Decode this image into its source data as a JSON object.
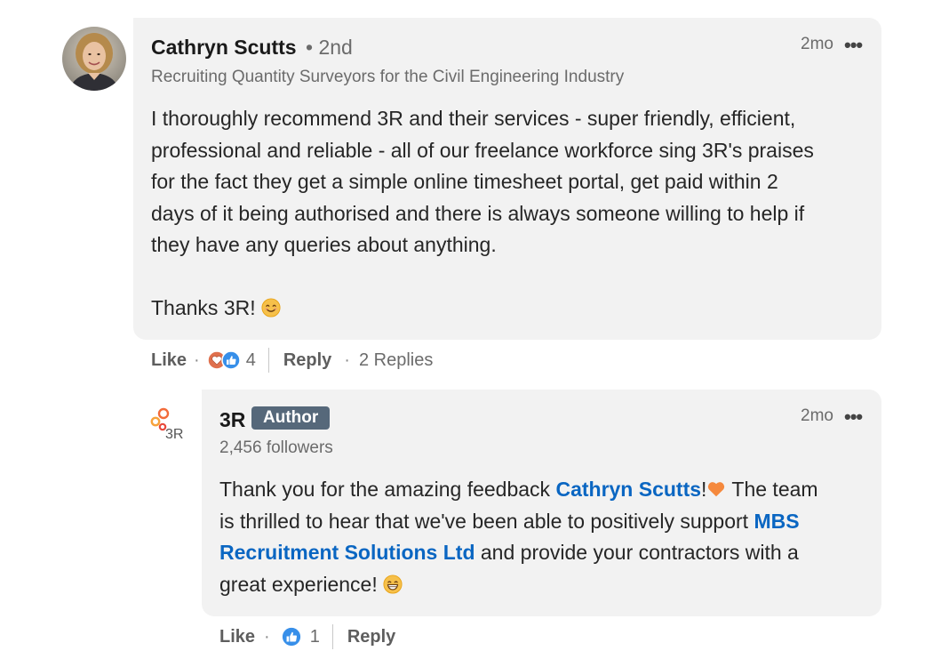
{
  "comment": {
    "author_name": "Cathryn Scutts",
    "connection_degree": "• 2nd",
    "headline": "Recruiting Quantity Surveyors for the Civil Engineering Industry",
    "time_ago": "2mo",
    "more_icon": "•••",
    "body_lines": [
      "I thoroughly recommend 3R and their services - super friendly, efficient,",
      "professional and reliable - all of our freelance workforce sing 3R's praises",
      "for the fact they get a simple online timesheet portal, get paid within 2",
      "days of it being authorised and there is always someone willing to help if",
      "they have any queries about anything."
    ],
    "thanks_text": "Thanks 3R!",
    "like_label": "Like",
    "reaction_count": "4",
    "reply_label": "Reply",
    "replies_label": "2 Replies"
  },
  "reply": {
    "author_name": "3R",
    "author_badge": "Author",
    "followers": "2,456 followers",
    "time_ago": "2mo",
    "more_icon": "•••",
    "line1_a": "Thank you for the amazing feedback ",
    "mention_person": "Cathryn Scutts",
    "line1_b": "!",
    "line1_c": " The team",
    "line2_a": "is thrilled to hear that we've been able to positively support ",
    "mention_company_1": "MBS",
    "mention_company_2": "Recruitment Solutions Ltd",
    "line3_b": " and provide your contractors with a",
    "line4_a": "great experience!",
    "like_label": "Like",
    "reaction_count": "1",
    "reply_label": "Reply"
  },
  "colors": {
    "bubble_bg": "#f2f2f2",
    "link_blue": "#0a66c2",
    "badge_bg": "#56687a",
    "muted_text": "#6b6b6b"
  },
  "icons": {
    "avatar": "profile-photo",
    "logo": "3r-company-logo",
    "reactions_main": [
      "love-reaction-icon",
      "like-reaction-icon"
    ],
    "reactions_reply": [
      "like-reaction-icon"
    ],
    "emoji_smile": "smiling-face-icon",
    "emoji_heart": "orange-heart-icon",
    "emoji_grin": "grinning-face-icon"
  }
}
